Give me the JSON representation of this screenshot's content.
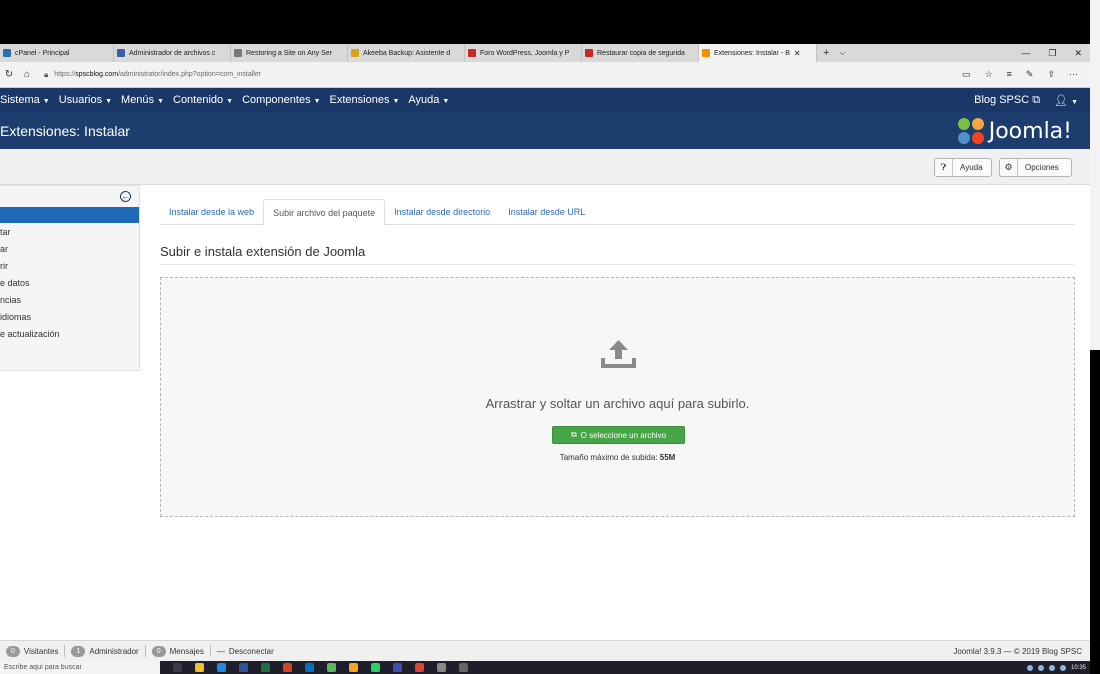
{
  "browser": {
    "tabs": [
      {
        "label": "cPanel - Principal",
        "fav": "#2a6fb0"
      },
      {
        "label": "Administrador de archivos c",
        "fav": "#3b5fa8"
      },
      {
        "label": "Restoring a Site on Any Ser",
        "fav": "#777777"
      },
      {
        "label": "Akeeba Backup: Asistente d",
        "fav": "#d9a21d"
      },
      {
        "label": "Foro WordPress, Joomla y P",
        "fav": "#c62828"
      },
      {
        "label": "Restaurar copia de segurida",
        "fav": "#c62828"
      },
      {
        "label": "Extensiones: Instalar - B",
        "fav": "#f29000",
        "active": true
      }
    ],
    "new_tab": "+",
    "tab_dropdown": "⌵",
    "window_controls": [
      "—",
      "❐",
      "✕"
    ],
    "url_scheme": "https://",
    "url_host": "spscblog.com",
    "url_path": "/administrator/index.php?option=com_installer"
  },
  "navbar": {
    "items": [
      {
        "label": "Sistema"
      },
      {
        "label": "Usuarios"
      },
      {
        "label": "Menús"
      },
      {
        "label": "Contenido"
      },
      {
        "label": "Componentes"
      },
      {
        "label": "Extensiones"
      },
      {
        "label": "Ayuda"
      }
    ],
    "site_link": "Blog SPSC",
    "user_icon": "user-icon"
  },
  "header": {
    "title": "Extensiones: Instalar",
    "logo_text": "Joomla!",
    "logo_colors": [
      "#7ac143",
      "#f9a541",
      "#f44321",
      "#5091cd"
    ]
  },
  "toolbar": {
    "help_label": "Ayuda",
    "options_label": "Opciones"
  },
  "sidebar": {
    "items": [
      "tar",
      "ar",
      "rir",
      "e datos",
      "ncias",
      "idiomas",
      "e actualización"
    ]
  },
  "tabs": [
    {
      "label": "Instalar desde la web",
      "active": false
    },
    {
      "label": "Subir archivo del paquete",
      "active": true
    },
    {
      "label": "Instalar desde directorio",
      "active": false
    },
    {
      "label": "Instalar desde URL",
      "active": false
    }
  ],
  "upload": {
    "section_title": "Subir e instala extensión de Joomla",
    "drop_text": "Arrastrar y soltar un archivo aquí para subirlo.",
    "select_button": "O seleccione un archivo",
    "max_size_label": "Tamaño máximo de subida:",
    "max_size_value": "55M"
  },
  "statusbar": {
    "visitors_count": "0",
    "visitors_label": "Visitantes",
    "admin_count": "1",
    "admin_label": "Administrador",
    "messages_count": "0",
    "messages_label": "Mensajes",
    "logout_label": "Desconectar",
    "version_text": "Joomla! 3.9.3 — © 2019 Blog SPSC"
  },
  "taskbar": {
    "search_placeholder": "Escribe aquí para buscar",
    "time": "10:35"
  }
}
